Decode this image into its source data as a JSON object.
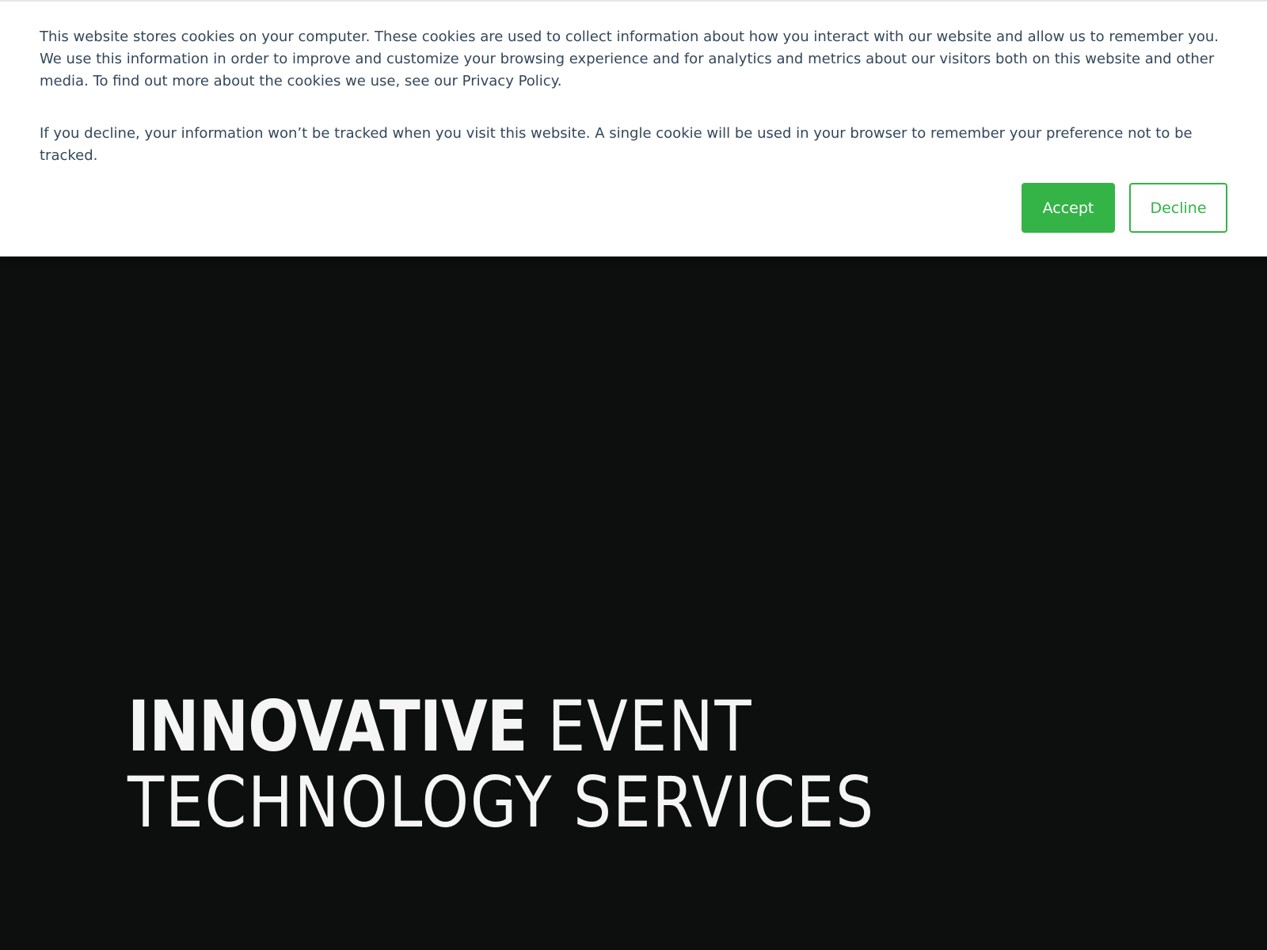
{
  "cookie_banner": {
    "paragraph1": "This website stores cookies on your computer. These cookies are used to collect information about how you interact with our website and allow us to remember you. We use this information in order to improve and customize your browsing experience and for analytics and metrics about our visitors both on this website and other media. To find out more about the cookies we use, see our Privacy Policy.",
    "paragraph2": "If you decline, your information won’t be tracked when you visit this website. A single cookie will be used in your browser to remember your preference not to be tracked.",
    "accept_label": "Accept",
    "decline_label": "Decline"
  },
  "hero": {
    "headline_bold": "INNOVATIVE",
    "headline_line1_rest": "EVENT",
    "headline_line2": "TECHNOLOGY SERVICES"
  },
  "colors": {
    "accent": "#34b347",
    "banner_text": "#33475b",
    "hero_background": "#0d0e0e",
    "hero_text": "#f5f5f5"
  }
}
